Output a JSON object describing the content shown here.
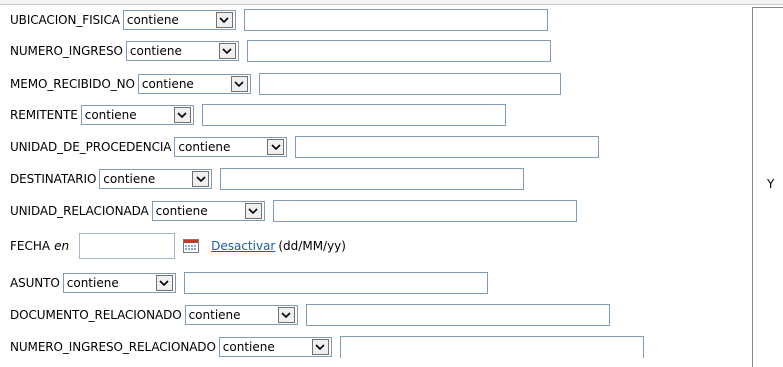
{
  "filters": [
    {
      "label": "UBICACION_FISICA",
      "operator": "contiene",
      "value": ""
    },
    {
      "label": "NUMERO_INGRESO",
      "operator": "contiene",
      "value": ""
    },
    {
      "label": "MEMO_RECIBIDO_NO",
      "operator": "contiene",
      "value": ""
    },
    {
      "label": "REMITENTE",
      "operator": "contiene",
      "value": ""
    },
    {
      "label": "UNIDAD_DE_PROCEDENCIA",
      "operator": "contiene",
      "value": ""
    },
    {
      "label": "DESTINATARIO",
      "operator": "contiene",
      "value": ""
    },
    {
      "label": "UNIDAD_RELACIONADA",
      "operator": "contiene",
      "value": ""
    },
    {
      "label": "ASUNTO",
      "operator": "contiene",
      "value": ""
    },
    {
      "label": "DOCUMENTO_RELACIONADO",
      "operator": "contiene",
      "value": ""
    },
    {
      "label": "NUMERO_INGRESO_RELACIONADO",
      "operator": "contiene",
      "value": ""
    }
  ],
  "fecha": {
    "label": "FECHA",
    "qualifier": "en",
    "value": "",
    "link": "Desactivar",
    "format": "(dd/MM/yy)"
  },
  "right_panel": {
    "connector": "Y"
  },
  "icons": {
    "dropdown": "chevron-down-icon",
    "calendar": "calendar-icon"
  }
}
